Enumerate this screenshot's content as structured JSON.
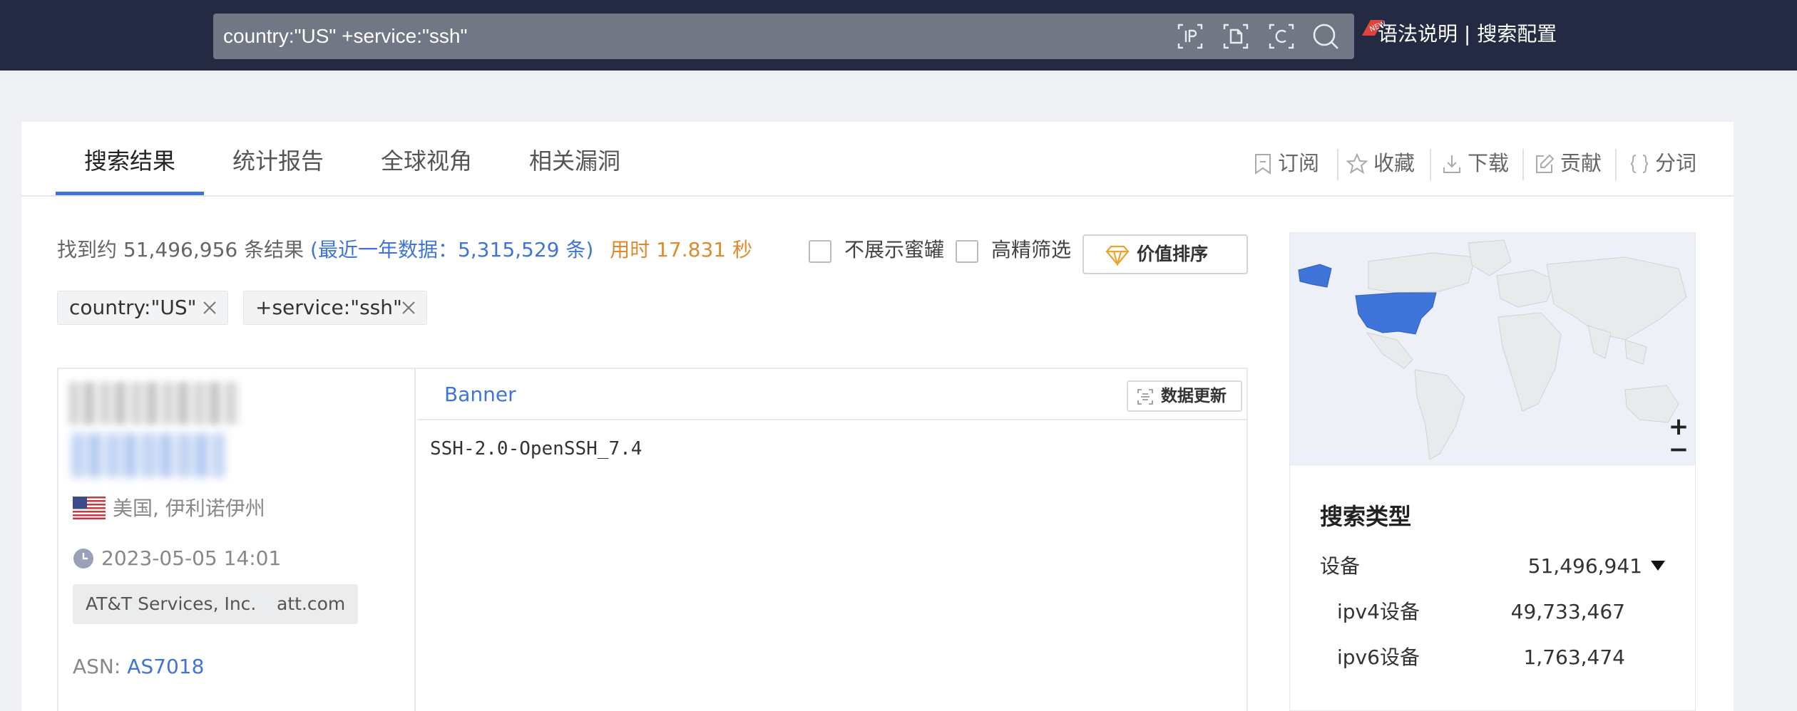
{
  "search": {
    "query": "country:\"US\" +service:\"ssh\"",
    "icons": [
      "ip-search-icon",
      "file-search-icon",
      "cert-search-icon",
      "search-icon"
    ],
    "syntax_link": "语法说明",
    "separator": "|",
    "config_link": "搜索配置",
    "new_badge": "new"
  },
  "tabs": [
    {
      "label": "搜索结果",
      "active": true
    },
    {
      "label": "统计报告",
      "active": false
    },
    {
      "label": "全球视角",
      "active": false
    },
    {
      "label": "相关漏洞",
      "active": false
    }
  ],
  "actions": [
    {
      "label": "订阅",
      "icon": "bookmark-icon"
    },
    {
      "label": "收藏",
      "icon": "star-icon"
    },
    {
      "label": "下载",
      "icon": "download-icon"
    },
    {
      "label": "贡献",
      "icon": "edit-icon"
    },
    {
      "label": "分词",
      "icon": "braces-icon"
    }
  ],
  "summary": {
    "found_prefix": "找到约 51,496,956 条结果",
    "recent_label": "(最近一年数据：",
    "recent_count": "5,315,529 条)",
    "elapsed": "用时 17.831 秒"
  },
  "filters": {
    "hide_honeypot": "不展示蜜罐",
    "high_precision": "高精筛选",
    "value_sort": "价值排序"
  },
  "chips": [
    "country:\"US\"",
    "+service:\"ssh\""
  ],
  "result": {
    "location": "美国, 伊利诺伊州",
    "datetime": "2023-05-05 14:01",
    "tags": [
      "AT&T Services, Inc.",
      "att.com"
    ],
    "asn_label": "ASN:",
    "asn_value": "AS7018",
    "banner_title": "Banner",
    "update_label": "数据更新",
    "banner_text": "SSH-2.0-OpenSSH_7.4"
  },
  "map": {
    "highlight_color": "#3f74d8",
    "zoom_in": "+",
    "zoom_out": "−"
  },
  "search_types": {
    "title": "搜索类型",
    "rows": [
      {
        "label": "设备",
        "count": "51,496,941"
      },
      {
        "label": "ipv4设备",
        "count": "49,733,467"
      },
      {
        "label": "ipv6设备",
        "count": "1,763,474"
      }
    ]
  }
}
